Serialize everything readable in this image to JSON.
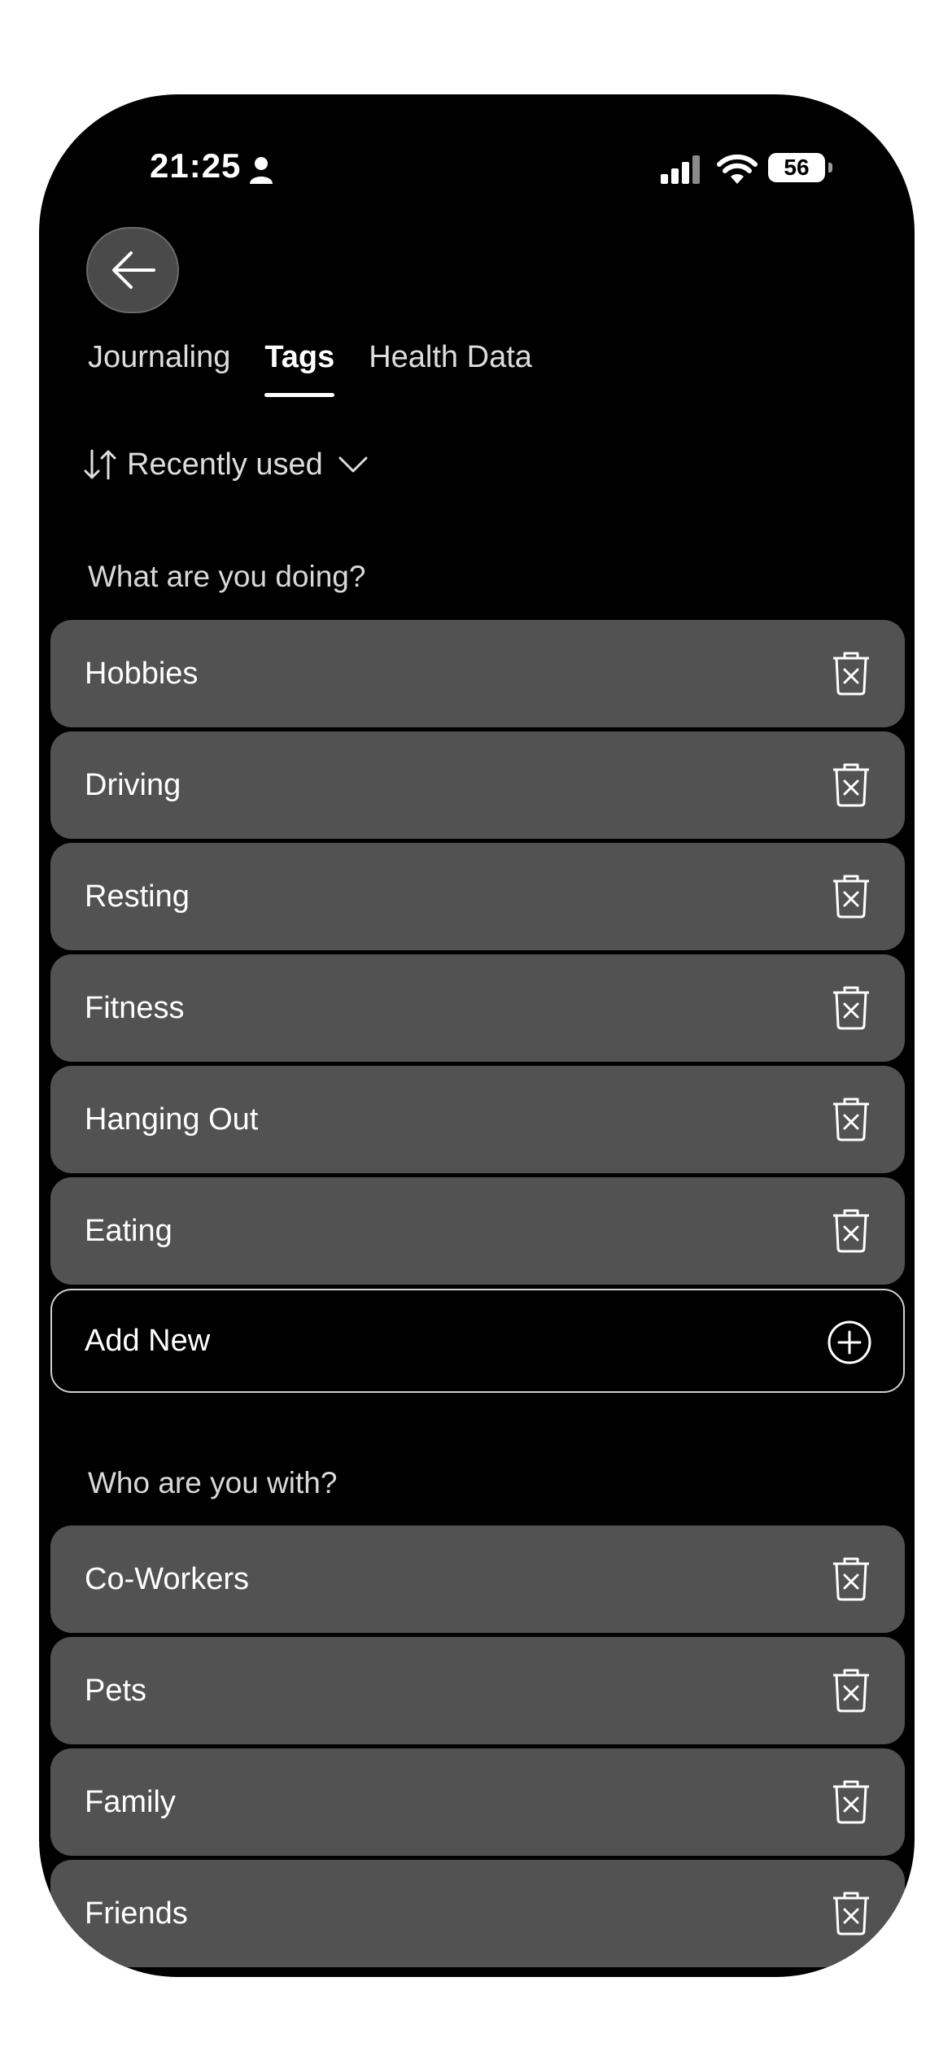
{
  "status_bar": {
    "time": "21:25",
    "battery": "56",
    "icons": [
      "person-icon",
      "signal-icon",
      "wifi-icon",
      "battery-icon"
    ]
  },
  "navigation": {
    "back_icon": "arrow-left-icon"
  },
  "tabs": [
    {
      "label": "Journaling",
      "active": false
    },
    {
      "label": "Tags",
      "active": true
    },
    {
      "label": "Health Data",
      "active": false
    }
  ],
  "sort": {
    "label": "Recently used",
    "icon": "sort-arrows-icon"
  },
  "sections": [
    {
      "title": "What are you doing?",
      "tags": [
        "Hobbies",
        "Driving",
        "Resting",
        "Fitness",
        "Hanging Out",
        "Eating"
      ],
      "add_label": "Add New"
    },
    {
      "title": "Who are you with?",
      "tags": [
        "Co-Workers",
        "Pets",
        "Family",
        "Friends"
      ]
    }
  ],
  "colors": {
    "background": "#000000",
    "row": "#525252",
    "text": "#ffffff"
  }
}
